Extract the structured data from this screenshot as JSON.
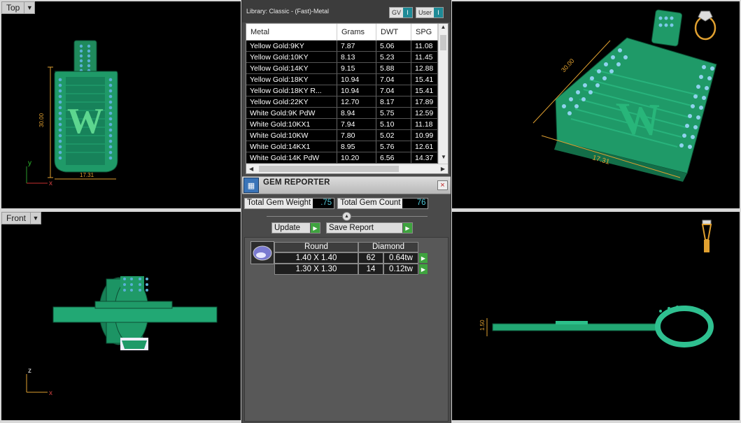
{
  "viewports": {
    "top": {
      "label": "Top",
      "dim_vertical": "30.00",
      "dim_horizontal": "17.31",
      "axis_v": "y",
      "axis_h": "x",
      "letter": "W"
    },
    "front": {
      "label": "Front",
      "axis_v": "z",
      "axis_h": "x"
    },
    "perspective": {
      "dim_length": "30.00",
      "dim_width": "17.31",
      "letter": "W"
    },
    "right": {
      "dim_thickness": "1.50"
    }
  },
  "library": {
    "title": "Library: Classic - (Fast)-Metal",
    "toggle_gv": "GV",
    "toggle_user": "User",
    "columns": [
      "Metal",
      "Grams",
      "DWT",
      "SPG"
    ],
    "rows": [
      [
        "Yellow Gold:9KY",
        "7.87",
        "5.06",
        "11.08"
      ],
      [
        "Yellow Gold:10KY",
        "8.13",
        "5.23",
        "11.45"
      ],
      [
        "Yellow Gold:14KY",
        "9.15",
        "5.88",
        "12.88"
      ],
      [
        "Yellow Gold:18KY",
        "10.94",
        "7.04",
        "15.41"
      ],
      [
        "Yellow Gold:18KY R...",
        "10.94",
        "7.04",
        "15.41"
      ],
      [
        "Yellow Gold:22KY",
        "12.70",
        "8.17",
        "17.89"
      ],
      [
        "White Gold:9K PdW",
        "8.94",
        "5.75",
        "12.59"
      ],
      [
        "White Gold:10KX1",
        "7.94",
        "5.10",
        "11.18"
      ],
      [
        "White Gold:10KW",
        "7.80",
        "5.02",
        "10.99"
      ],
      [
        "White Gold:14KX1",
        "8.95",
        "5.76",
        "12.61"
      ],
      [
        "White Gold:14K PdW",
        "10.20",
        "6.56",
        "14.37"
      ]
    ]
  },
  "gem_reporter": {
    "title": "GEM REPORTER",
    "close_icon": "×",
    "total_weight_label": "Total Gem Weight",
    "total_weight_value": ".75",
    "total_count_label": "Total Gem Count",
    "total_count_value": "76",
    "update_label": "Update",
    "save_label": "Save Report",
    "grid_header": {
      "shape": "Round",
      "type": "Diamond"
    },
    "grid_rows": [
      {
        "size": "1.40 X 1.40",
        "count": "62",
        "weight": "0.64tw"
      },
      {
        "size": "1.30 X 1.30",
        "count": "14",
        "weight": "0.12tw"
      }
    ]
  },
  "colors": {
    "model_green": "#22a06e",
    "dim_orange": "#e0a030",
    "value_cyan": "#4fc6d6",
    "go_green": "#3fa33f"
  }
}
